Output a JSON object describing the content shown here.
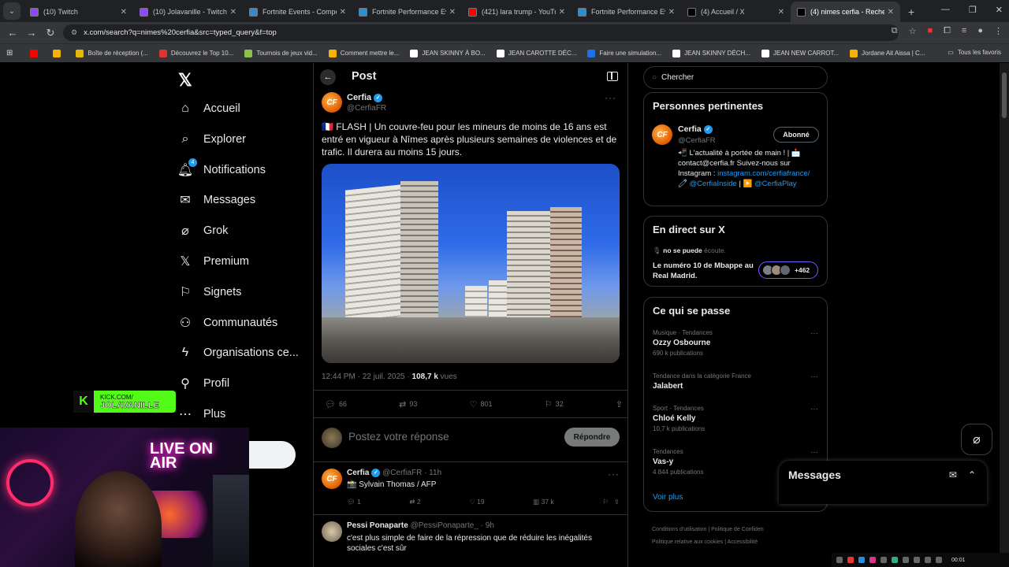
{
  "browser": {
    "tabs": [
      {
        "label": "(10) Twitch",
        "icon": "twitch-icon",
        "color": "#9146ff",
        "active": false
      },
      {
        "label": "(10) Jolavanille - Twitch",
        "icon": "twitch-icon",
        "color": "#9146ff",
        "active": false
      },
      {
        "label": "Fortnite Events - Compet",
        "icon": "fortnite-icon",
        "color": "#2b8fd6",
        "active": false
      },
      {
        "label": "Fortnite Performance Eval",
        "icon": "fortnite-icon",
        "color": "#2b8fd6",
        "active": false
      },
      {
        "label": "(421) lara trump - YouTub",
        "icon": "youtube-icon",
        "color": "#ff0000",
        "active": false
      },
      {
        "label": "Fortnite Performance Eval",
        "icon": "fortnite-icon",
        "color": "#2b8fd6",
        "active": false
      },
      {
        "label": "(4) Accueil / X",
        "icon": "x-icon",
        "color": "#000000",
        "active": false
      },
      {
        "label": "(4) nimes cerfia - Recherc",
        "icon": "x-icon",
        "color": "#000000",
        "active": true
      }
    ],
    "url": "x.com/search?q=nimes%20cerfia&src=typed_query&f=top",
    "bookmarks": [
      "Boîte de réception (...",
      "Découvrez le Top 10...",
      "Tournois de jeux vid...",
      "Comment mettre le...",
      "JEAN SKINNY À BO...",
      "JEAN CAROTTE DÉC...",
      "Faire une simulation...",
      "JEAN SKINNY DÉCH...",
      "JEAN NEW CARROT...",
      "Jordane Ait Aissa | C..."
    ],
    "bookmarks_all": "Tous les favoris"
  },
  "nav": {
    "items": [
      {
        "label": "Accueil",
        "icon": "home-icon"
      },
      {
        "label": "Explorer",
        "icon": "search-icon"
      },
      {
        "label": "Notifications",
        "icon": "bell-icon",
        "badge": "4"
      },
      {
        "label": "Messages",
        "icon": "mail-icon"
      },
      {
        "label": "Grok",
        "icon": "grok-icon"
      },
      {
        "label": "Premium",
        "icon": "x-icon"
      },
      {
        "label": "Signets",
        "icon": "bookmark-icon"
      },
      {
        "label": "Communautés",
        "icon": "people-icon"
      },
      {
        "label": "Organisations ce...",
        "icon": "bolt-icon"
      },
      {
        "label": "Profil",
        "icon": "person-icon"
      },
      {
        "label": "Plus",
        "icon": "more-circle-icon"
      }
    ]
  },
  "main": {
    "title": "Post",
    "tweet": {
      "name": "Cerfia",
      "handle": "@CerfiaFR",
      "text": "🇫🇷 FLASH | Un couvre-feu pour les mineurs de moins de 16 ans est entré en vigueur à Nîmes après plusieurs semaines de violences et de trafic. Il durera au moins 15 jours.",
      "time": "12:44 PM · 22 juil. 2025 · ",
      "views": "108,7 k",
      "views_label": "vues",
      "replies": "66",
      "retweets": "93",
      "likes": "801",
      "bookmarks": "32"
    },
    "reply_placeholder": "Postez votre réponse",
    "reply_button": "Répondre",
    "replies": [
      {
        "name": "Cerfia",
        "handle": "@CerfiaFR · 11h",
        "text": "📸 Sylvain Thomas / AFP",
        "replies": "1",
        "retweets": "2",
        "likes": "19",
        "views": "37 k"
      },
      {
        "name": "Pessi Ponaparte",
        "handle": "@PessiPonaparte_ · 9h",
        "text": "c'est plus simple de faire de la répression que de réduire les inégalités sociales c'est sûr"
      }
    ]
  },
  "right": {
    "search_placeholder": "Chercher",
    "relevant": {
      "title": "Personnes pertinentes",
      "name": "Cerfia",
      "handle": "@CerfiaFR",
      "follow": "Abonné",
      "bio_1": "📲 L'actualité à portée de main ! | 📩 contact@cerfia.fr Suivez-nous sur Instagram : ",
      "bio_link1": "instagram.com/cerfiafrance/",
      "bio_2": " 🧷 ",
      "bio_link2": "@CerfiaInside",
      "bio_3": " | ▶️ ",
      "bio_link3": "@CerfiaPlay"
    },
    "live": {
      "title": "En direct sur X",
      "host": "no se puede",
      "host_suffix": " écoute.",
      "text": "Le numéro 10 de Mbappe au Real Madrid.",
      "count": "+462"
    },
    "trends": {
      "title": "Ce qui se passe",
      "items": [
        {
          "category": "Musique · Tendances",
          "name": "Ozzy Osbourne",
          "count": "690 k publications"
        },
        {
          "category": "Tendance dans la catégorie France",
          "name": "Jalabert",
          "count": ""
        },
        {
          "category": "Sport · Tendances",
          "name": "Chloé Kelly",
          "count": "10,7 k publications"
        },
        {
          "category": "Tendances",
          "name": "Vas-y",
          "count": "4 844 publications"
        }
      ],
      "more": "Voir plus"
    },
    "footer": {
      "line1": "Conditions d'utilisation | Politique de Confiden",
      "line2": "Politique relative aux cookies | Accessibilité"
    }
  },
  "messages_drawer": {
    "title": "Messages"
  },
  "overlay": {
    "kick_top": "KICK.COM/",
    "kick_name": "JOLAVANILLE",
    "neon_text": "LIVE ON AIR"
  },
  "tray": {
    "time": "00:01"
  }
}
